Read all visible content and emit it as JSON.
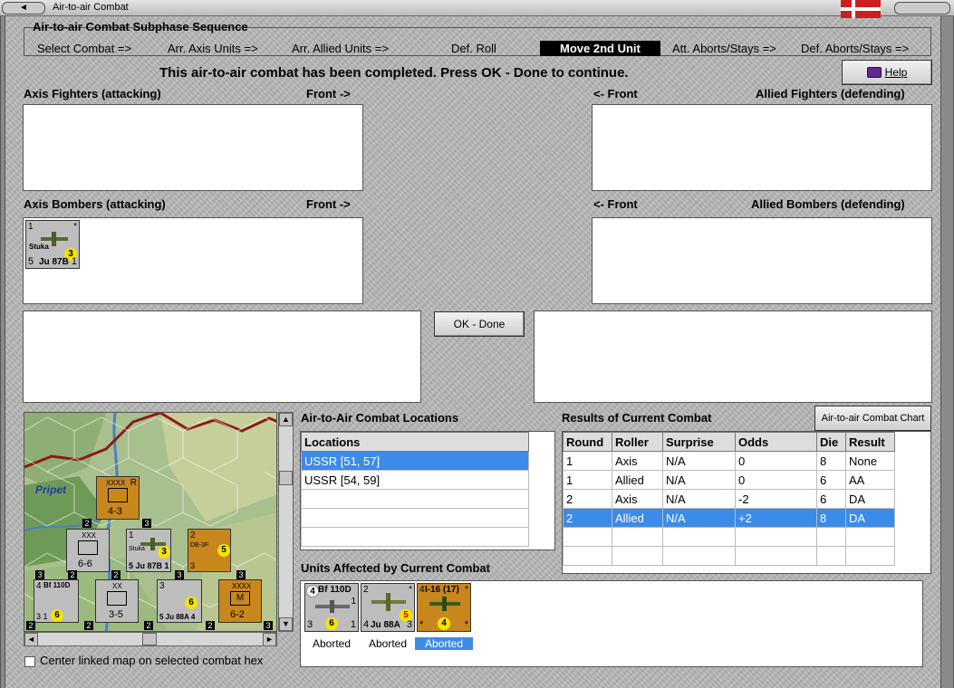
{
  "window": {
    "title": "Air-to-air Combat",
    "back_label": "◄"
  },
  "sequence": {
    "title": "Air-to-air Combat Subphase Sequence",
    "steps": [
      {
        "label": "Select Combat =>"
      },
      {
        "label": "Arr. Axis Units =>"
      },
      {
        "label": "Arr. Allied Units =>"
      },
      {
        "label": "Def. Roll"
      },
      {
        "label": "Move 2nd Unit"
      },
      {
        "label": "Att. Aborts/Stays =>"
      },
      {
        "label": "Def. Aborts/Stays =>"
      }
    ],
    "active_index": 4
  },
  "message": "This air-to-air combat has been completed.  Press OK - Done to continue.",
  "help_button": {
    "label": "Help"
  },
  "panels": {
    "axis_fighters": {
      "label": "Axis Fighters (attacking)",
      "front": "Front ->"
    },
    "allied_fighters": {
      "label": "Allied Fighters (defending)",
      "front": "<- Front"
    },
    "axis_bombers": {
      "label": "Axis Bombers (attacking)",
      "front": "Front ->"
    },
    "allied_bombers": {
      "label": "Allied Bombers (defending)",
      "front": "<- Front"
    }
  },
  "axis_bomber_unit": {
    "top_left": "1",
    "top_right": "*",
    "type": "Stuka",
    "circle": "3",
    "bottom_left": "5",
    "name": "Ju 87B",
    "bottom_right": "1"
  },
  "ok_button": {
    "label": "OK - Done"
  },
  "map": {
    "label_pripet": "Pripet",
    "counters": [
      {
        "tl": "",
        "tr": "R",
        "mid": "XXXX",
        "bottom": "4-3",
        "color": "orange"
      },
      {
        "tl": "",
        "tr": "XXX",
        "mid": "",
        "bottom": "6-6",
        "color": "grey"
      },
      {
        "tl": "1",
        "tr": "",
        "mid": "Stuka",
        "bottom": "5 Ju 87B 1",
        "circle": "3",
        "color": "grey"
      },
      {
        "tl": "2",
        "tr": "",
        "mid": "DB-3F",
        "bottom": "3",
        "circle": "5",
        "color": "orange"
      },
      {
        "tl": "4",
        "tr": "",
        "mid": "Bf 110D",
        "bottom": "3  1",
        "circle": "6",
        "color": "grey"
      },
      {
        "tl": "",
        "tr": "XX",
        "mid": "",
        "bottom": "3-5",
        "color": "grey"
      },
      {
        "tl": "3",
        "tr": "",
        "mid": "",
        "bottom": "5 Ju 88A 4",
        "circle": "6",
        "color": "grey"
      },
      {
        "tl": "",
        "tr": "XXXX",
        "mid": "M",
        "bottom": "6-2",
        "color": "orange"
      }
    ],
    "badges": [
      "2",
      "3",
      "2",
      "2",
      "3",
      "3",
      "3",
      "2",
      "2",
      "2",
      "3",
      "2"
    ]
  },
  "locations": {
    "title": "Air-to-Air Combat Locations",
    "header": "Locations",
    "rows": [
      "USSR [51, 57]",
      "USSR [54, 59]",
      "",
      "",
      "",
      ""
    ],
    "selected_index": 0
  },
  "results": {
    "title": "Results of Current Combat",
    "chart_button": "Air-to-air Combat Chart",
    "headers": [
      "Round",
      "Roller",
      "Surprise",
      "Odds",
      "Die",
      "Result"
    ],
    "rows": [
      [
        "1",
        "Axis",
        "N/A",
        "0",
        "8",
        "None"
      ],
      [
        "1",
        "Allied",
        "N/A",
        "0",
        "6",
        "AA"
      ],
      [
        "2",
        "Axis",
        "N/A",
        "-2",
        "6",
        "DA"
      ],
      [
        "2",
        "Allied",
        "N/A",
        "+2",
        "8",
        "DA"
      ],
      [
        "",
        "",
        "",
        "",
        "",
        ""
      ],
      [
        "",
        "",
        "",
        "",
        "",
        ""
      ]
    ],
    "selected_index": 3
  },
  "affected": {
    "title": "Units Affected by Current Combat",
    "units": [
      {
        "tl": "4",
        "name": "Bf 110D",
        "tr": "1",
        "bl": "3",
        "br": "1",
        "circle": "6",
        "status": "Aborted",
        "color": "grey"
      },
      {
        "tl": "2",
        "name": "",
        "tr": "*",
        "bl": "4",
        "bottom_name": "Ju 88A",
        "br": "3",
        "circle": "5",
        "status": "Aborted",
        "color": "grey"
      },
      {
        "tl": "4",
        "name": "I-16 (17)",
        "tr": "*",
        "bl": "*",
        "br": "*",
        "circle": "4",
        "status": "Aborted",
        "color": "orange"
      }
    ],
    "selected_index": 2
  },
  "center_checkbox": {
    "label": "Center linked map on selected combat hex",
    "checked": false
  },
  "colors": {
    "selection": "#3d8be8",
    "counter_orange": "#c8871c",
    "counter_grey": "#bdbdbd",
    "strength_circle": "#f5e400",
    "border_line": "#8b1a1a"
  }
}
